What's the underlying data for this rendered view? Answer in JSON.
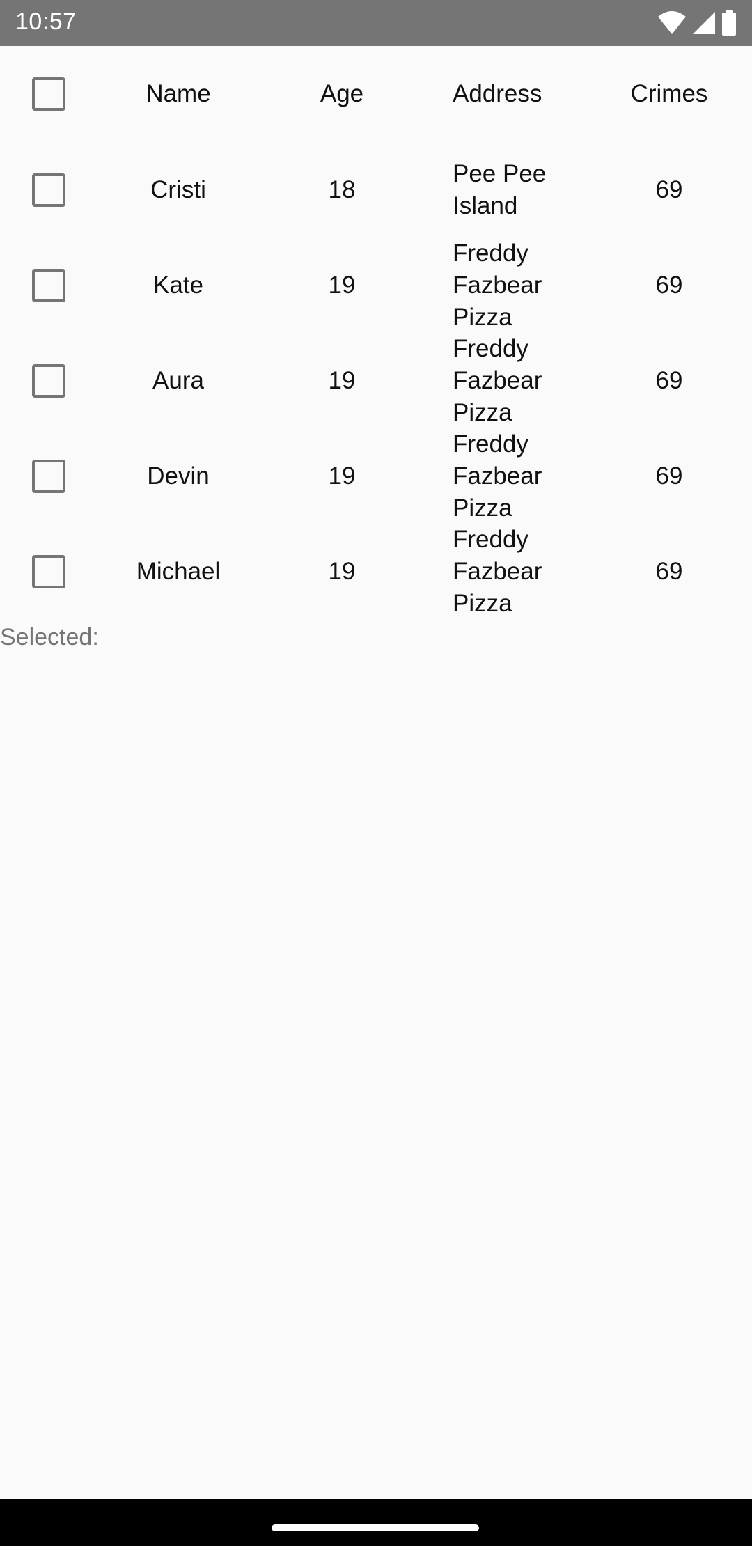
{
  "status_bar": {
    "time": "10:57"
  },
  "table": {
    "headers": {
      "name": "Name",
      "age": "Age",
      "address": "Address",
      "crimes": "Crimes"
    },
    "rows": [
      {
        "name": "Cristi",
        "age": "18",
        "address": "Pee Pee Island",
        "crimes": "69",
        "checked": false
      },
      {
        "name": "Kate",
        "age": "19",
        "address": "Freddy Fazbear Pizza",
        "crimes": "69",
        "checked": false
      },
      {
        "name": "Aura",
        "age": "19",
        "address": "Freddy Fazbear Pizza",
        "crimes": "69",
        "checked": false
      },
      {
        "name": "Devin",
        "age": "19",
        "address": "Freddy Fazbear Pizza",
        "crimes": "69",
        "checked": false
      },
      {
        "name": "Michael",
        "age": "19",
        "address": "Freddy Fazbear Pizza",
        "crimes": "69",
        "checked": false
      }
    ]
  },
  "selection": {
    "label": "Selected:"
  },
  "colors": {
    "status_bar": "#757575",
    "background": "#fafafa",
    "checkbox_border": "#757575",
    "nav_bar": "#000000"
  }
}
